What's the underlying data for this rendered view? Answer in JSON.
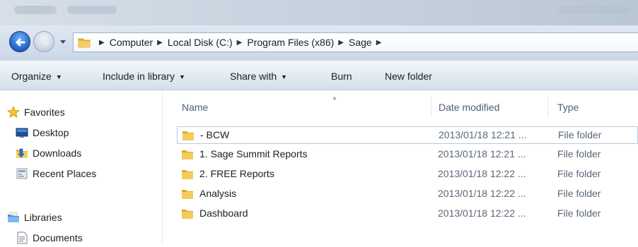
{
  "breadcrumbs": [
    "Computer",
    "Local Disk (C:)",
    "Program Files (x86)",
    "Sage"
  ],
  "toolbar": {
    "organize": "Organize",
    "include_in_library": "Include in library",
    "share_with": "Share with",
    "burn": "Burn",
    "new_folder": "New folder"
  },
  "nav": {
    "favorites": "Favorites",
    "desktop": "Desktop",
    "downloads": "Downloads",
    "recent_places": "Recent Places",
    "libraries": "Libraries",
    "documents": "Documents"
  },
  "columns": {
    "name": "Name",
    "date_modified": "Date modified",
    "type": "Type"
  },
  "files": [
    {
      "name": "- BCW",
      "date": "2013/01/18 12:21 ...",
      "type": "File folder"
    },
    {
      "name": "1. Sage Summit Reports",
      "date": "2013/01/18 12:21 ...",
      "type": "File folder"
    },
    {
      "name": "2. FREE Reports",
      "date": "2013/01/18 12:22 ...",
      "type": "File folder"
    },
    {
      "name": "Analysis",
      "date": "2013/01/18 12:22 ...",
      "type": "File folder"
    },
    {
      "name": "Dashboard",
      "date": "2013/01/18 12:22 ...",
      "type": "File folder"
    }
  ],
  "colors": {
    "accent": "#1f5fbf",
    "folder": "#e8b43a",
    "header_text": "#4c607a"
  }
}
